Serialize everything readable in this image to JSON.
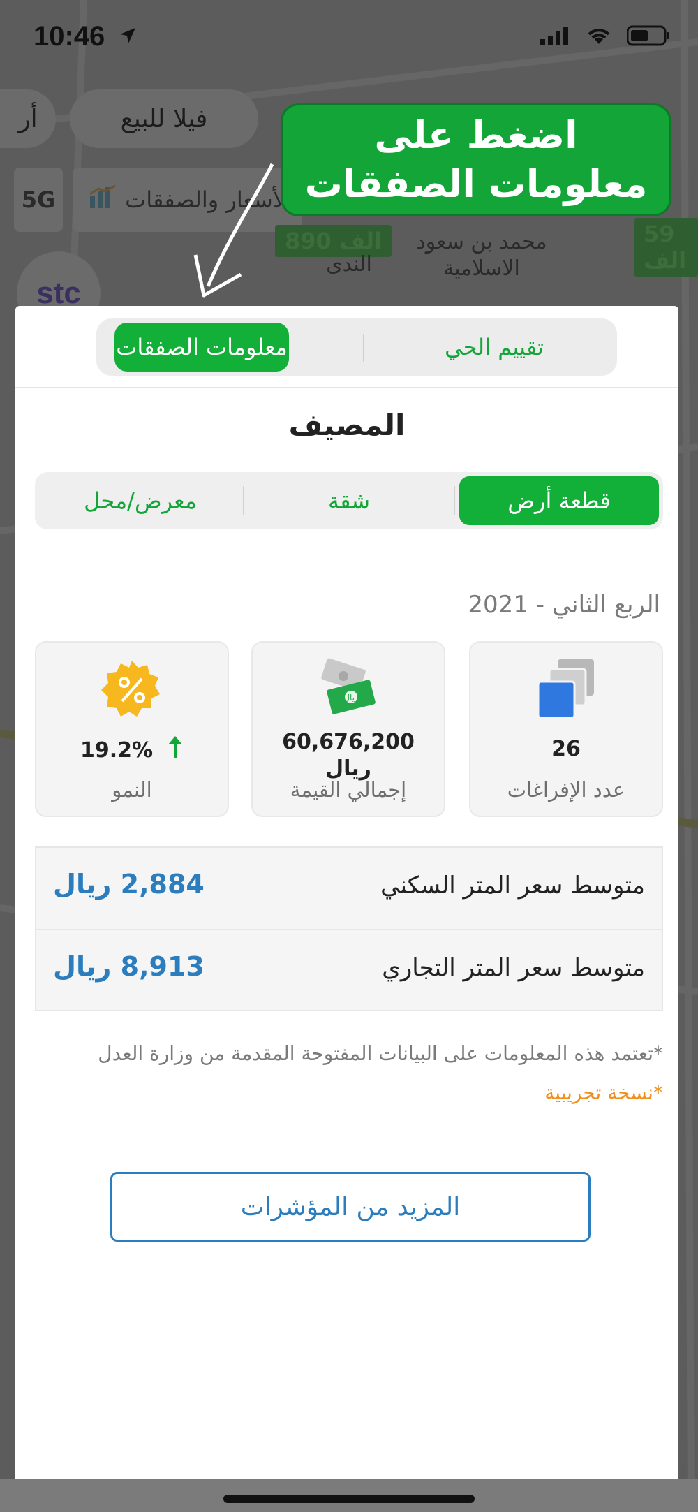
{
  "status_bar": {
    "time": "10:46"
  },
  "map": {
    "chips": [
      "فيلا للبيع",
      "أر"
    ],
    "filter_label": "الأسعار والصفقات",
    "network": "5G",
    "price_tags": [
      "890 الف",
      "59 الف"
    ],
    "labels": [
      "محمد بن سعود الاسلامية",
      "الندى"
    ],
    "carrier_logo": "stc"
  },
  "callout": {
    "text": "اضغط على معلومات الصفقات"
  },
  "sheet": {
    "tabs": {
      "deals": "معلومات الصفقات",
      "rating": "تقييم الحي"
    },
    "district": "المصيف",
    "property_types": {
      "land": "قطعة أرض",
      "apartment": "شقة",
      "shop": "معرض/محل"
    },
    "quarter": "الربع الثاني - 2021",
    "stats": {
      "transfers": {
        "value": "26",
        "label": "عدد الإفراغات"
      },
      "total": {
        "value": "60,676,200",
        "unit": "ريال",
        "label": "إجمالي القيمة"
      },
      "growth": {
        "value": "19.2%",
        "label": "النمو"
      }
    },
    "prices": [
      {
        "label": "متوسط سعر المتر السكني",
        "value": "2,884 ريال"
      },
      {
        "label": "متوسط سعر المتر التجاري",
        "value": "8,913 ريال"
      }
    ],
    "note": "*تعتمد هذه المعلومات على البيانات المفتوحة المقدمة من وزارة العدل",
    "beta": "*نسخة تجريبية",
    "more_button": "المزيد من المؤشرات"
  },
  "colors": {
    "accent_green": "#12b039",
    "link_blue": "#2b7dbd",
    "beta_orange": "#f0901e"
  }
}
